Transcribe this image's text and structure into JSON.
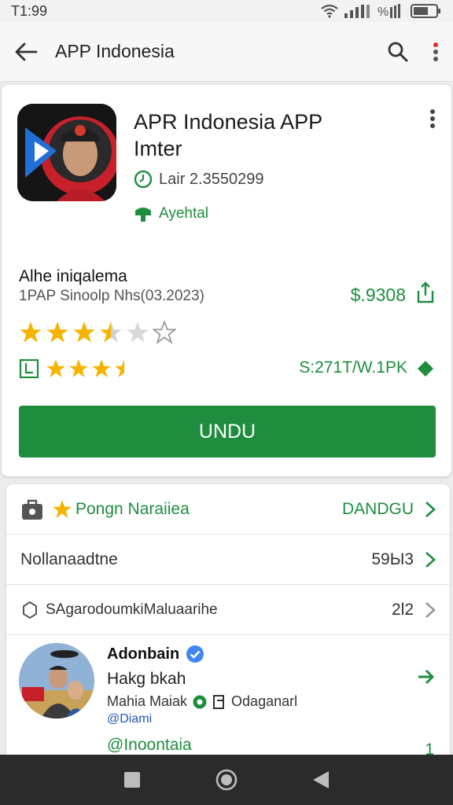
{
  "status_bar": {
    "time": "T1:99"
  },
  "app_bar": {
    "title": "APP Indonesia"
  },
  "app": {
    "name_line1": "APR Indonesia APP",
    "name_line2": "Imter",
    "version": "Lair 2.3550299",
    "verified": "Ayehtal",
    "subtitle": "Alhe iniqalema",
    "meta": "1PAP Sinoolp Nhs(03.2023)",
    "price": "$.9308",
    "size": "S:271T/W.1PK",
    "rating_stars_top": 3.5,
    "rating_stars_second": 3.5,
    "install_label": "UNDU"
  },
  "list": {
    "row1": {
      "label": "Pongn Naraiiea",
      "value": "DANDGU"
    },
    "row2": {
      "label": "Nollanaadtne",
      "value": "59Ы3"
    },
    "row3": {
      "label": "SAgarodoumkiMaluaarihe",
      "value": "2l2"
    }
  },
  "developer": {
    "name": "Adonbain",
    "line2": "Hakg bkah",
    "left_label": "Mahia Maiak",
    "right_label": "Odaganarl",
    "handle": "@Diami",
    "handle2": "@Inoontaia",
    "count2": "1"
  },
  "colors": {
    "accent": "#1e8e3e",
    "star": "#f4b400",
    "link": "#1a56b8"
  }
}
